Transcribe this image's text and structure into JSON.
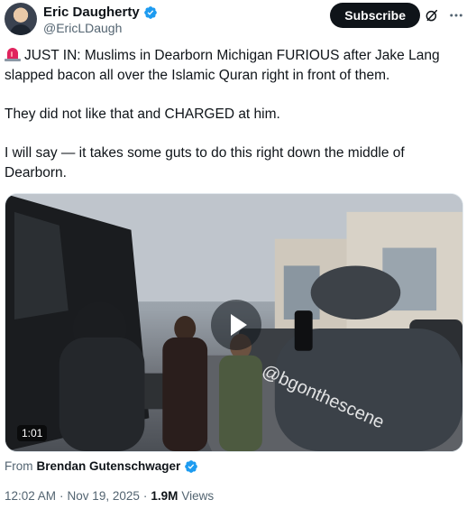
{
  "author": {
    "name": "Eric Daugherty",
    "handle": "@EricLDaugh",
    "verified": true,
    "verified_color": "#1d9bf0"
  },
  "actions": {
    "subscribe_label": "Subscribe",
    "grok_icon": "grok-icon",
    "more_icon": "more-icon"
  },
  "tweet": {
    "paragraphs": [
      "JUST IN: Muslims in Dearborn Michigan FURIOUS after Jake Lang slapped bacon all over the Islamic Quran right in front of them.",
      "They did not like that and CHARGED at him.",
      "I will say — it takes some guts to do this right down the middle of Dearborn."
    ],
    "emoji_icon": "siren-icon"
  },
  "media": {
    "type": "video",
    "duration": "1:01",
    "watermark_text": "@bgonthescene",
    "play_icon": "play-icon"
  },
  "source": {
    "label": "From",
    "name": "Brendan Gutenschwager",
    "verified": true
  },
  "meta": {
    "time": "12:02 AM",
    "separator": "·",
    "date": "Nov 19, 2025",
    "views_count": "1.9M",
    "views_label": "Views"
  }
}
